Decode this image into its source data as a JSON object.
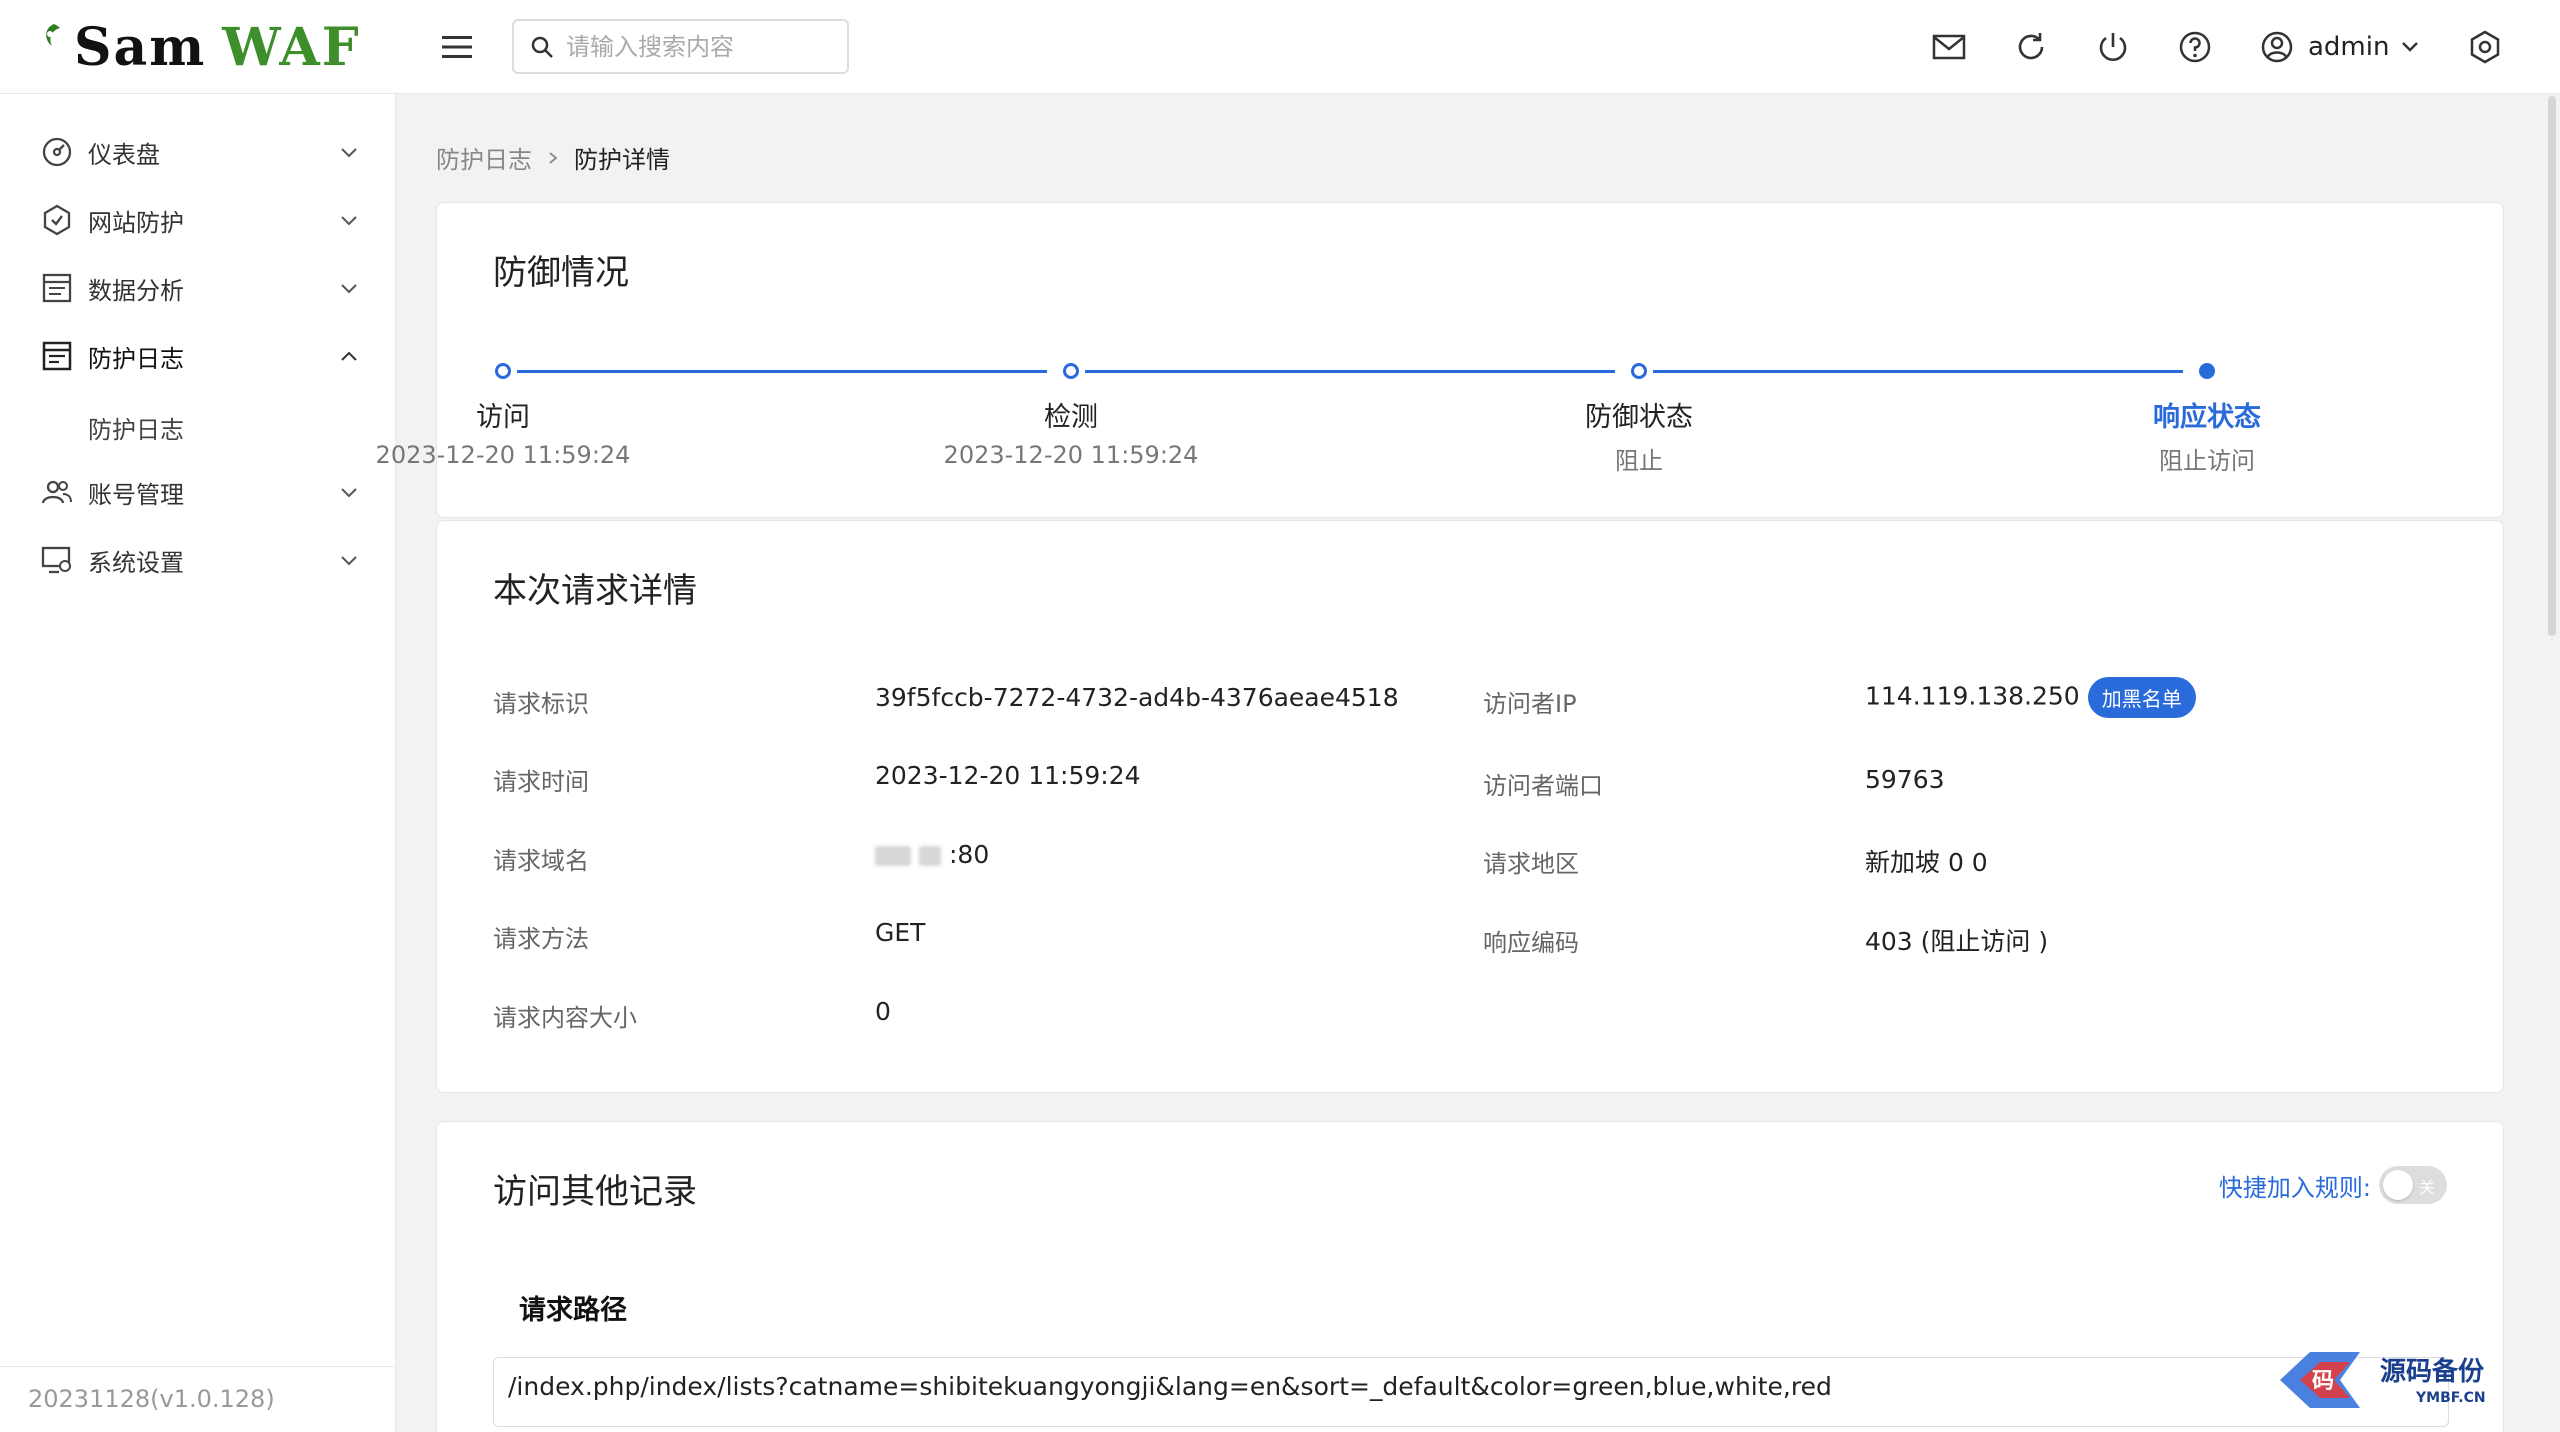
{
  "app": {
    "logo_text": "SamWAF",
    "logo_left": "Sam",
    "logo_right": "WAF",
    "brand_color": "#3e8e2b",
    "accent_color": "#2a6bdc"
  },
  "header": {
    "search_placeholder": "请输入搜索内容",
    "user_name": "admin",
    "icons": [
      "menu-icon",
      "search-icon",
      "mail-icon",
      "refresh-icon",
      "power-icon",
      "help-icon",
      "user-icon",
      "settings-icon"
    ]
  },
  "sidebar": {
    "items": [
      {
        "label": "仪表盘",
        "icon": "dashboard-icon"
      },
      {
        "label": "网站防护",
        "icon": "shield-icon"
      },
      {
        "label": "数据分析",
        "icon": "analysis-icon"
      },
      {
        "label": "防护日志",
        "icon": "log-icon",
        "expanded": true,
        "children": [
          {
            "label": "防护日志"
          }
        ]
      },
      {
        "label": "账号管理",
        "icon": "users-icon"
      },
      {
        "label": "系统设置",
        "icon": "system-settings-icon"
      }
    ],
    "version": "20231128(v1.0.128)"
  },
  "breadcrumb": {
    "parent": "防护日志",
    "current": "防护详情"
  },
  "defense": {
    "title": "防御情况",
    "steps": [
      {
        "name": "访问",
        "desc": "2023-12-20 11:59:24"
      },
      {
        "name": "检测",
        "desc": "2023-12-20 11:59:24"
      },
      {
        "name": "防御状态",
        "desc": "阻止"
      },
      {
        "name": "响应状态",
        "desc": "阻止访问"
      }
    ]
  },
  "request": {
    "title": "本次请求详情",
    "left": [
      {
        "label": "请求标识",
        "value": "39f5fccb-7272-4732-ad4b-4376aeae4518"
      },
      {
        "label": "请求时间",
        "value": "2023-12-20 11:59:24"
      },
      {
        "label": "请求域名",
        "value": ":80"
      },
      {
        "label": "请求方法",
        "value": "GET"
      },
      {
        "label": "请求内容大小",
        "value": "0"
      }
    ],
    "right": [
      {
        "label": "访问者IP",
        "value": "114.119.138.250",
        "badge": "加黑名单"
      },
      {
        "label": "访问者端口",
        "value": "59763"
      },
      {
        "label": "请求地区",
        "value": "新加坡 0 0"
      },
      {
        "label": "响应编码",
        "value": "403 (阻止访问 )"
      }
    ]
  },
  "other": {
    "title": "访问其他记录",
    "quick_label": "快捷加入规则:",
    "toggle_text": "关",
    "toggle_on": false,
    "path_title": "请求路径",
    "path_value": "/index.php/index/lists?catname=shibitekuangyongji&lang=en&sort=_default&color=green,blue,white,red"
  },
  "watermark": {
    "text": "源码备份",
    "sub": "YMBF.CN"
  }
}
